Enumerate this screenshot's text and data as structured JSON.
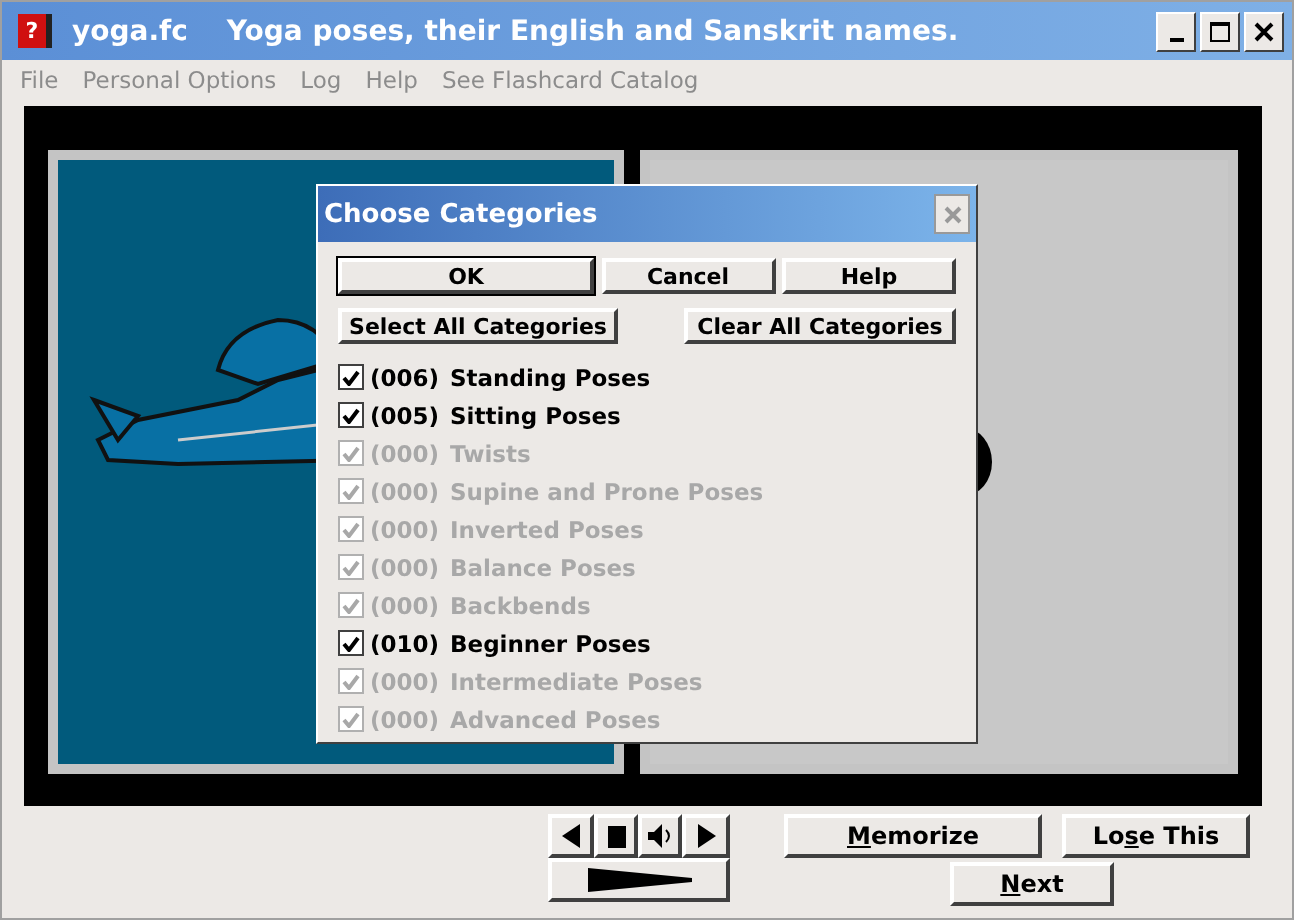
{
  "window": {
    "icon_text": "?",
    "title": "yoga.fc    Yoga poses, their English and Sanskrit names."
  },
  "menu": [
    {
      "label": "File",
      "disabled": true
    },
    {
      "label": "Personal Options",
      "disabled": true
    },
    {
      "label": "Log",
      "disabled": true
    },
    {
      "label": "Help",
      "disabled": true
    },
    {
      "label": "See Flashcard Catalog",
      "disabled": true
    }
  ],
  "dialog": {
    "title": "Choose Categories",
    "buttons": [
      {
        "label": "OK",
        "default": true
      },
      {
        "label": "Cancel",
        "default": false
      },
      {
        "label": "Help",
        "default": false
      }
    ],
    "select_all": "Select All Categories",
    "clear_all": "Clear All Categories",
    "categories": [
      {
        "count": "(006)",
        "name": "Standing Poses",
        "checked": true,
        "disabled": false
      },
      {
        "count": "(005)",
        "name": "Sitting Poses",
        "checked": true,
        "disabled": false
      },
      {
        "count": "(000)",
        "name": "Twists",
        "checked": true,
        "disabled": true
      },
      {
        "count": "(000)",
        "name": "Supine and Prone Poses",
        "checked": true,
        "disabled": true
      },
      {
        "count": "(000)",
        "name": "Inverted Poses",
        "checked": true,
        "disabled": true
      },
      {
        "count": "(000)",
        "name": "Balance Poses",
        "checked": true,
        "disabled": true
      },
      {
        "count": "(000)",
        "name": "Backbends",
        "checked": true,
        "disabled": true
      },
      {
        "count": "(010)",
        "name": "Beginner Poses",
        "checked": true,
        "disabled": false
      },
      {
        "count": "(000)",
        "name": "Intermediate Poses",
        "checked": true,
        "disabled": true
      },
      {
        "count": "(000)",
        "name": "Advanced Poses",
        "checked": true,
        "disabled": true
      }
    ]
  },
  "actions": [
    {
      "key": "M",
      "post": "emorize"
    },
    {
      "pre": "Lo",
      "key": "s",
      "post": "e This"
    },
    {
      "key": "N",
      "post": "ext"
    }
  ]
}
